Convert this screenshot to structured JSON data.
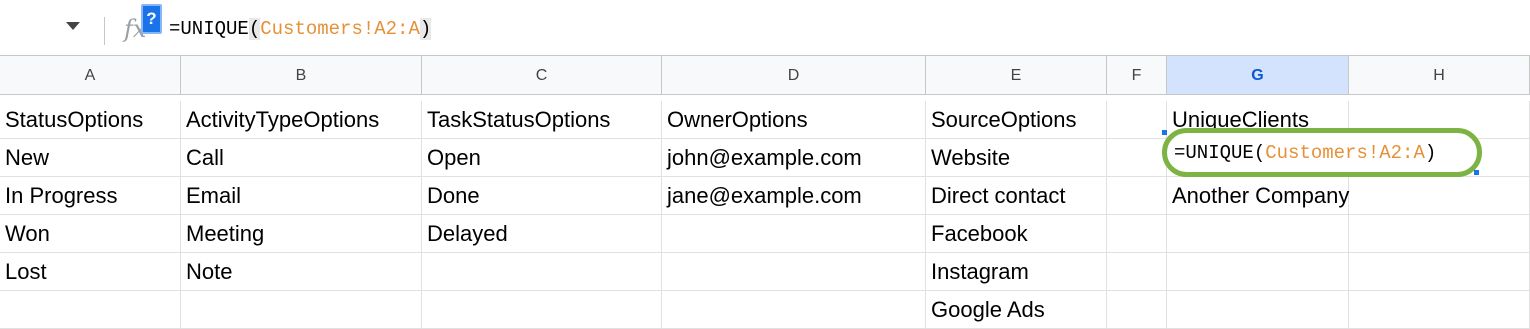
{
  "formula_bar": {
    "help_badge": "?",
    "fx_label": "fx",
    "formula": {
      "prefix": "=UNIQUE",
      "open_paren": "(",
      "reference": "Customers!A2:A",
      "close_paren": ")"
    }
  },
  "columns": [
    "A",
    "B",
    "C",
    "D",
    "E",
    "F",
    "G",
    "H"
  ],
  "selected_column": "G",
  "rows": [
    [
      "StatusOptions",
      "ActivityTypeOptions",
      "TaskStatusOptions",
      "OwnerOptions",
      "SourceOptions",
      "",
      "UniqueClients",
      ""
    ],
    [
      "New",
      "Call",
      "Open",
      "john@example.com",
      "Website",
      "",
      "",
      ""
    ],
    [
      "In Progress",
      "Email",
      "Done",
      "jane@example.com",
      "Direct contact",
      "",
      "Another Company",
      ""
    ],
    [
      "Won",
      "Meeting",
      "Delayed",
      "",
      "Facebook",
      "",
      "",
      ""
    ],
    [
      "Lost",
      "Note",
      "",
      "",
      "Instagram",
      "",
      "",
      ""
    ],
    [
      "",
      "",
      "",
      "",
      "Google Ads",
      "",
      "",
      ""
    ]
  ],
  "active_cell_editor": {
    "prefix": "=UNIQUE",
    "open_paren": "(",
    "reference": "Customers!A2:A",
    "close_paren": ")"
  },
  "colors": {
    "reference": "#e69138",
    "selected_header": "#d3e3fd",
    "highlight_ring": "#7cb342"
  }
}
